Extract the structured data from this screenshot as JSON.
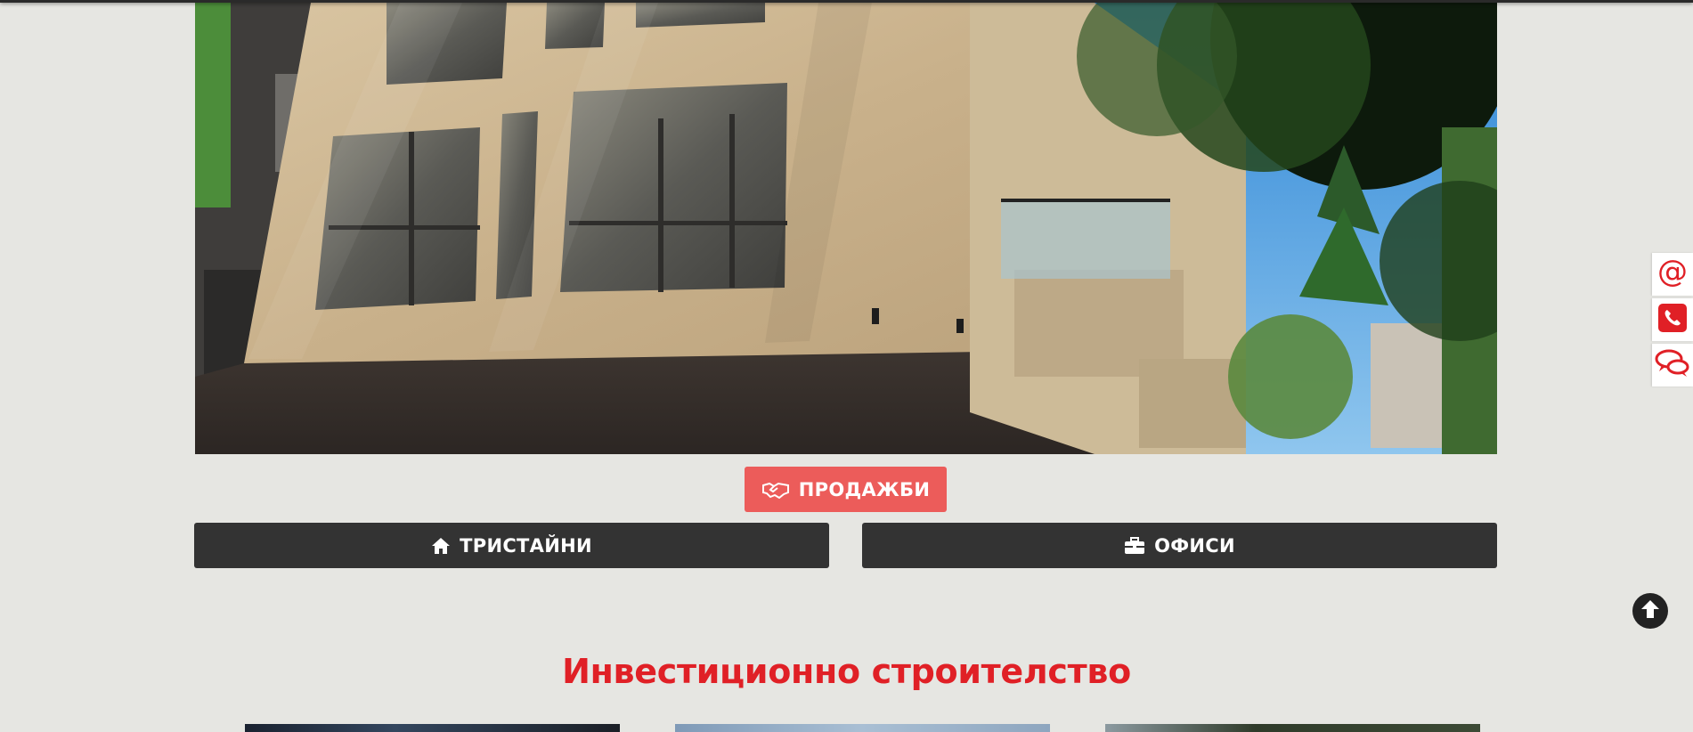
{
  "hero": {
    "image_alt": "Residential building facade with balconies and trees"
  },
  "buttons": {
    "sales_label": "ПРОДАЖБИ",
    "sales_icon": "handshake-icon",
    "three_room_label": "ТРИСТАЙНИ",
    "three_room_icon": "home-icon",
    "offices_label": "ОФИСИ",
    "offices_icon": "briefcase-icon"
  },
  "side_contact": [
    {
      "icon": "email-at-icon"
    },
    {
      "icon": "phone-icon"
    },
    {
      "icon": "chat-icon"
    }
  ],
  "back_to_top_icon": "arrow-up-circle-icon",
  "section": {
    "title": "Инвестиционно строителство"
  },
  "colors": {
    "page_bg": "#e6e6e2",
    "accent_red": "#e02026",
    "sales_button": "#ec5c5a",
    "dark_button": "#333333"
  }
}
